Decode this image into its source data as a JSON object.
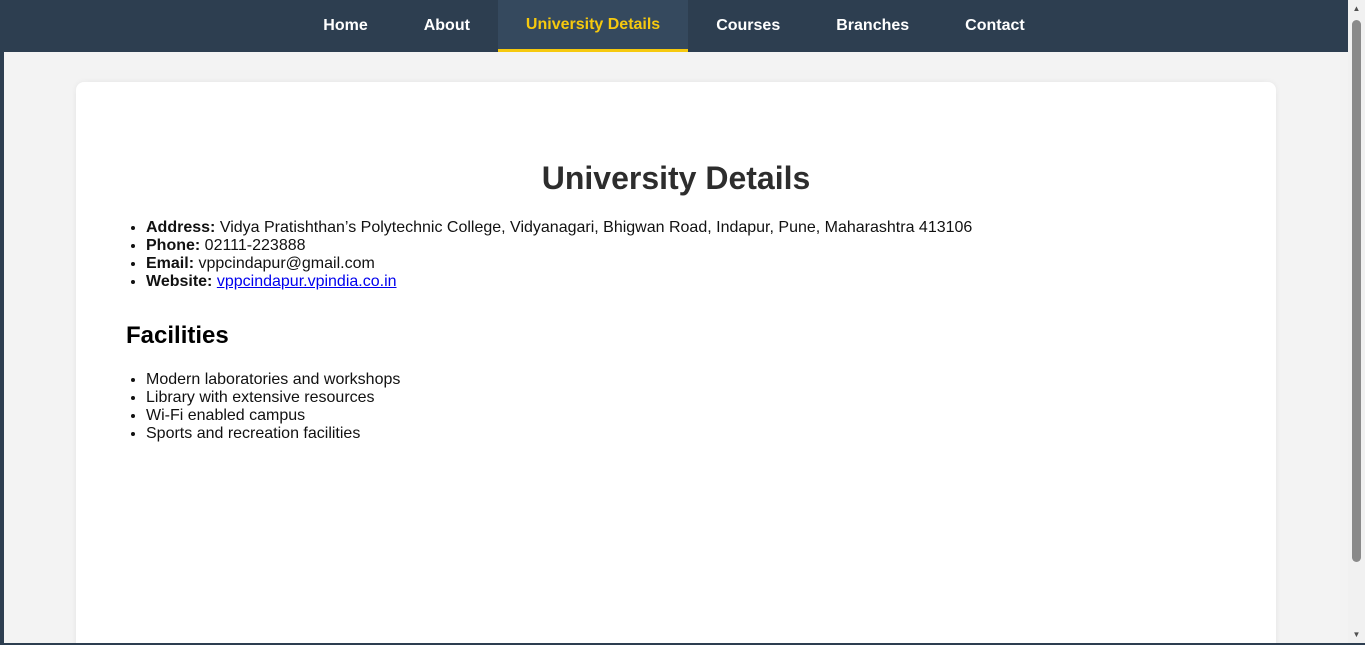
{
  "nav": {
    "items": [
      {
        "label": "Home"
      },
      {
        "label": "About"
      },
      {
        "label": "University Details"
      },
      {
        "label": "Courses"
      },
      {
        "label": "Branches"
      },
      {
        "label": "Contact"
      }
    ],
    "active_color": "#f6c90e",
    "bg_color": "#2d3e50"
  },
  "main": {
    "title": "University Details",
    "details": [
      {
        "label": "Address:",
        "value": "Vidya Pratishthan’s Polytechnic College, Vidyanagari, Bhigwan Road, Indapur, Pune, Maharashtra 413106"
      },
      {
        "label": "Phone:",
        "value": "02111-223888"
      },
      {
        "label": "Email:",
        "value": "vppcindapur@gmail.com"
      },
      {
        "label": "Website:",
        "value": "vppcindapur.vpindia.co.in"
      }
    ],
    "facilities_title": "Facilities",
    "facilities": [
      "Modern laboratories and workshops",
      "Library with extensive resources",
      "Wi-Fi enabled campus",
      "Sports and recreation facilities"
    ]
  },
  "icons": {
    "scroll_up": "chevron-up-icon",
    "scroll_down": "chevron-down-icon"
  }
}
